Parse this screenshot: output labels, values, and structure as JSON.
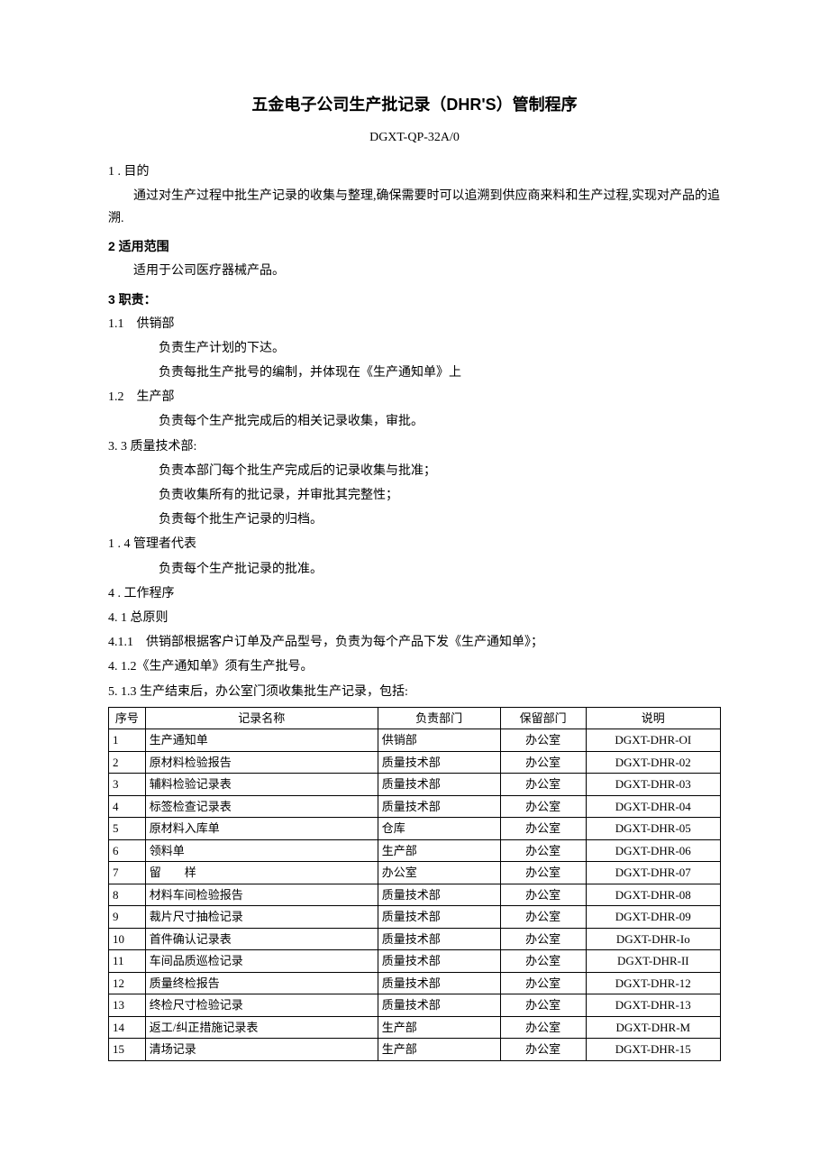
{
  "title": "五金电子公司生产批记录（DHR'S）管制程序",
  "doc_code": "DGXT-QP-32A/0",
  "s1_num": "1 . 目的",
  "s1_p1": "通过对生产过程中批生产记录的收集与整理,确保需要时可以追溯到供应商来料和生产过程,实现对产品的追溯.",
  "s2_num": "2 适用范围",
  "s2_p1": "适用于公司医疗器械产品。",
  "s3_num": "3 职责：",
  "s3_1_num": "1.1　供销部",
  "s3_1_p1": "负责生产计划的下达。",
  "s3_1_p2": "负责每批生产批号的编制，并体现在《生产通知单》上",
  "s3_2_num": "1.2　生产部",
  "s3_2_p1": "负责每个生产批完成后的相关记录收集，审批。",
  "s3_3_num": "3. 3 质量技术部:",
  "s3_3_p1": "负责本部门每个批生产完成后的记录收集与批准；",
  "s3_3_p2": "负责收集所有的批记录，并审批其完整性；",
  "s3_3_p3": "负责每个批生产记录的归档。",
  "s3_4_num": "1 . 4 管理者代表",
  "s3_4_p1": "负责每个生产批记录的批准。",
  "s4_num": "4 . 工作程序",
  "s4_1_num": "4. 1 总原则",
  "s4_1_1": "4.1.1　供销部根据客户订单及产品型号，负责为每个产品下发《生产通知单》；",
  "s4_1_2": "4. 1.2《生产通知单》须有生产批号。",
  "s4_1_3": "5. 1.3 生产结束后，办公室门须收集批生产记录，包括:",
  "table": {
    "headers": [
      "序号",
      "记录名称",
      "负责部门",
      "保留部门",
      "说明"
    ],
    "rows": [
      [
        "1",
        "生产通知单",
        "供销部",
        "办公室",
        "DGXT-DHR-OI"
      ],
      [
        "2",
        "原材料检验报告",
        "质量技术部",
        "办公室",
        "DGXT-DHR-02"
      ],
      [
        "3",
        "辅料检验记录表",
        "质量技术部",
        "办公室",
        "DGXT-DHR-03"
      ],
      [
        "4",
        "标签检查记录表",
        "质量技术部",
        "办公室",
        "DGXT-DHR-04"
      ],
      [
        "5",
        "原材料入库单",
        "仓库",
        "办公室",
        "DGXT-DHR-05"
      ],
      [
        "6",
        "领料单",
        "生产部",
        "办公室",
        "DGXT-DHR-06"
      ],
      [
        "7",
        "留　　样",
        "办公室",
        "办公室",
        "DGXT-DHR-07"
      ],
      [
        "8",
        "材料车间检验报告",
        "质量技术部",
        "办公室",
        "DGXT-DHR-08"
      ],
      [
        "9",
        "裁片尺寸抽检记录",
        "质量技术部",
        "办公室",
        "DGXT-DHR-09"
      ],
      [
        "10",
        "首件确认记录表",
        "质量技术部",
        "办公室",
        "DGXT-DHR-Io"
      ],
      [
        "11",
        "车间品质巡检记录",
        "质量技术部",
        "办公室",
        "DGXT-DHR-II"
      ],
      [
        "12",
        "质量终检报告",
        "质量技术部",
        "办公室",
        "DGXT-DHR-12"
      ],
      [
        "13",
        "终检尺寸检验记录",
        "质量技术部",
        "办公室",
        "DGXT-DHR-13"
      ],
      [
        "14",
        "返工/纠正措施记录表",
        "生产部",
        "办公室",
        "DGXT-DHR-M"
      ],
      [
        "15",
        "清场记录",
        "生产部",
        "办公室",
        "DGXT-DHR-15"
      ]
    ]
  }
}
